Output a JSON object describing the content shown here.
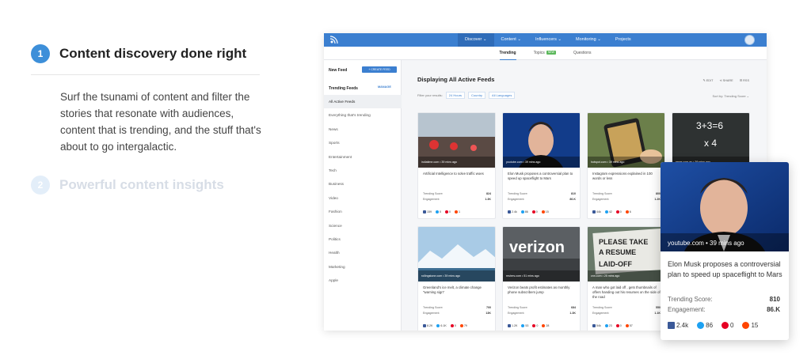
{
  "left": {
    "step1": {
      "number": "1",
      "title": "Content discovery done right"
    },
    "description": "Surf the tsunami of content and filter the stories that resonate with audiences, content that is trending, and the stuff that's about to go intergalactic.",
    "step2": {
      "number": "2",
      "title": "Powerful content insights"
    }
  },
  "app": {
    "nav": [
      "Discover ⌄",
      "Content ⌄",
      "Influencers ⌄",
      "Monitoring ⌄",
      "Projects"
    ],
    "subnav": {
      "trending": "Trending",
      "topics": "Topics",
      "topics_badge": "NEW",
      "questions": "Questions"
    },
    "sidebar": {
      "new_feed": "New Feed",
      "create_feed": "+ CREATE FEED",
      "trending_feeds": "Trending Feeds",
      "manage": "MANAGE",
      "items": [
        "All Active Feeds",
        "Everything that's trending",
        "News",
        "Sports",
        "Entertainment",
        "Tech",
        "Business",
        "Video",
        "Fashion",
        "Science",
        "Politics",
        "Health",
        "Marketing",
        "Apple"
      ]
    },
    "main": {
      "title": "Displaying All Active Feeds",
      "edit": "✎ EDIT",
      "share": "⋖ SHARE",
      "rss": "☰ RSS",
      "filter_label": "Filter your results:",
      "filters": [
        "24 Hours",
        "Country",
        "All Languages"
      ],
      "sort": "Sort by: Trending Score ⌄",
      "score_label": "Trending Score:",
      "engagement_label": "Engagement:"
    },
    "cards": [
      {
        "source": "indiatime.com • 39 mins ago",
        "title": "Artificial Intelligence to solve traffic woes",
        "score": "824",
        "engagement": "1.3K",
        "fb": "159",
        "tw": "0",
        "pi": "0",
        "rd": "1"
      },
      {
        "source": "youtube.com • 39 mins ago",
        "title": "Elon Musk proposes a controversial plan to speed up spaceflight to Mars",
        "score": "810",
        "engagement": "86.K",
        "fb": "2.4k",
        "tw": "86",
        "pi": "0",
        "rd": "15"
      },
      {
        "source": "hotspot.com • 39 mins ago",
        "title": "Instagram expressions explained in 100 words or less",
        "score": "800",
        "engagement": "1.2K",
        "fb": "44k",
        "tw": "42",
        "pi": "0",
        "rd": "6"
      },
      {
        "source": "news.com.au • 39 mins ago",
        "title": "",
        "score": "",
        "engagement": "",
        "fb": "",
        "tw": "",
        "pi": "",
        "rd": ""
      },
      {
        "source": "rollingstone.com • 39 mins ago",
        "title": "Greenland's ice melt, a climate change \"warning sign\"",
        "score": "700",
        "engagement": "13K",
        "fb": "8.2K",
        "tw": "6.1K",
        "pi": "0",
        "rd": "79"
      },
      {
        "source": "reuters.com • 51 mins ago",
        "title": "Verizon beats profit estimates as monthly phone subscribers jump",
        "score": "684",
        "engagement": "1.3K",
        "fb": "1.2K",
        "tw": "53",
        "pi": "0",
        "rd": "28"
      },
      {
        "source": "cnn.com • 25 mins ago",
        "title": "A man who got laid off , gets thumbnails of offers handing out his resumes on the side of the road",
        "score": "550",
        "engagement": "1.1K",
        "fb": "54k",
        "tw": "23",
        "pi": "0",
        "rd": "57"
      }
    ]
  },
  "float_card": {
    "source": "youtube.com • 39 mins ago",
    "title": "Elon Musk proposes a controversial plan to speed up spaceflight to Mars",
    "score_label": "Trending Score:",
    "score": "810",
    "engagement_label": "Engagement:",
    "engagement": "86.K",
    "fb": "2.4k",
    "tw": "86",
    "pi": "0",
    "rd": "15"
  },
  "colors": {
    "accent": "#3b7fd0",
    "step1": "#3d8fd9",
    "step2_faded": "#d7dde6"
  },
  "icons": [
    "app-logo-icon",
    "user-avatar-icon",
    "facebook-icon",
    "twitter-icon",
    "pinterest-icon",
    "reddit-icon"
  ]
}
